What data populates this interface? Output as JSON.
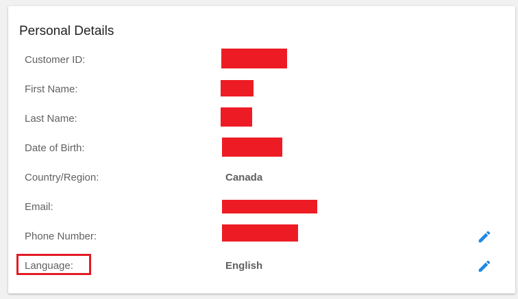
{
  "card": {
    "title": "Personal Details"
  },
  "fields": [
    {
      "label": "Customer ID:",
      "value": "",
      "redacted": true
    },
    {
      "label": "First Name:",
      "value": "",
      "redacted": true
    },
    {
      "label": "Last Name:",
      "value": "",
      "redacted": true
    },
    {
      "label": "Date of Birth:",
      "value": "",
      "redacted": true
    },
    {
      "label": "Country/Region:",
      "value": "Canada",
      "redacted": false
    },
    {
      "label": "Email:",
      "value": "",
      "redacted": true
    },
    {
      "label": "Phone Number:",
      "value": "",
      "redacted": true,
      "editable": true
    },
    {
      "label": "Language:",
      "value": "English",
      "redacted": false,
      "editable": true,
      "highlighted": true
    }
  ],
  "icons": {
    "edit": "pencil-icon"
  },
  "colors": {
    "accent": "#1e88e5",
    "redaction": "#ed1c24",
    "highlight": "#e21b23"
  }
}
